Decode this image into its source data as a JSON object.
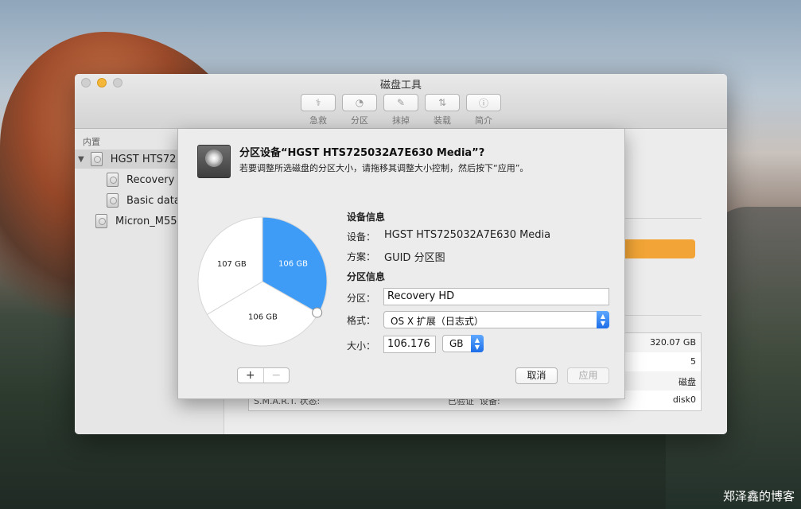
{
  "window": {
    "title": "磁盘工具",
    "toolbar": [
      {
        "label": "急救",
        "icon": "stethoscope-icon",
        "glyph": "⚕"
      },
      {
        "label": "分区",
        "icon": "partition-icon",
        "glyph": "◔"
      },
      {
        "label": "抹掉",
        "icon": "erase-icon",
        "glyph": "✎"
      },
      {
        "label": "装载",
        "icon": "mount-icon",
        "glyph": "⇅"
      },
      {
        "label": "简介",
        "icon": "info-icon",
        "glyph": "ⓘ"
      }
    ]
  },
  "sidebar": {
    "section": "内置",
    "items": [
      {
        "label": "HGST HTS72"
      },
      {
        "label": "Recovery I"
      },
      {
        "label": "Basic data"
      },
      {
        "label": "Micron_M55"
      }
    ]
  },
  "info_table": {
    "capacity": "320.07 GB",
    "count": "5",
    "type": "磁盘",
    "smart_label": "S.M.A.R.T. 状态:",
    "smart_value": "已验证",
    "device_label": "设备:",
    "device_value": "disk0"
  },
  "sheet": {
    "title": "分区设备“HGST HTS725032A7E630 Media”?",
    "subtitle": "若要调整所选磁盘的分区大小，请拖移其调整大小控制，然后按下“应用”。",
    "device_info_heading": "设备信息",
    "device_label": "设备：",
    "device_value": "HGST HTS725032A7E630 Media",
    "scheme_label": "方案：",
    "scheme_value": "GUID 分区图",
    "partition_info_heading": "分区信息",
    "partition_label": "分区：",
    "partition_value": "Recovery HD",
    "format_label": "格式：",
    "format_value": "OS X 扩展（日志式）",
    "size_label": "大小：",
    "size_value": "106.176",
    "size_unit": "GB",
    "add_label": "+",
    "remove_label": "−",
    "cancel_label": "取消",
    "apply_label": "应用",
    "pie": {
      "slices": [
        {
          "label": "106 GB",
          "value": 106,
          "selected": true,
          "color": "#3f9cf6"
        },
        {
          "label": "106 GB",
          "value": 106,
          "selected": false,
          "color": "#ffffff"
        },
        {
          "label": "107 GB",
          "value": 107,
          "selected": false,
          "color": "#ffffff"
        }
      ]
    }
  },
  "watermark": "郑泽鑫的博客"
}
